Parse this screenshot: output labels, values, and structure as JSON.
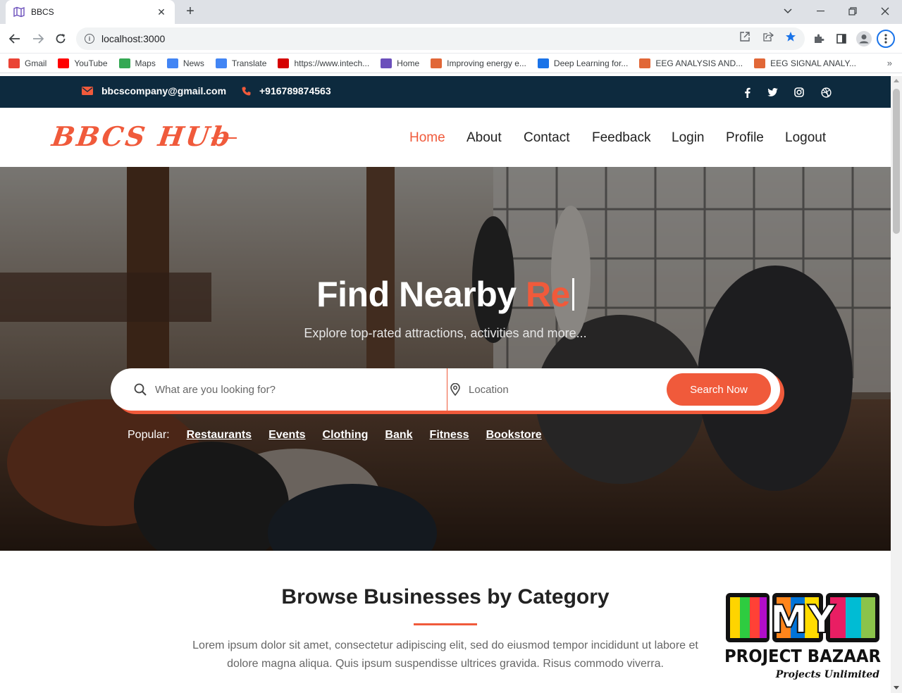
{
  "browser": {
    "tab_title": "BBCS",
    "url": "localhost:3000",
    "bookmarks": [
      {
        "label": "Gmail",
        "icon": "gmail-icon",
        "color": "#ea4335"
      },
      {
        "label": "YouTube",
        "icon": "youtube-icon",
        "color": "#ff0000"
      },
      {
        "label": "Maps",
        "icon": "maps-icon",
        "color": "#34a853"
      },
      {
        "label": "News",
        "icon": "news-icon",
        "color": "#4285f4"
      },
      {
        "label": "Translate",
        "icon": "translate-icon",
        "color": "#4285f4"
      },
      {
        "label": "https://www.intech...",
        "icon": "intech-icon",
        "color": "#d50000"
      },
      {
        "label": "Home",
        "icon": "map-outline-icon",
        "color": "#6b4fbb"
      },
      {
        "label": "Improving energy e...",
        "icon": "matlab-icon",
        "color": "#e16737"
      },
      {
        "label": "Deep Learning for...",
        "icon": "document-icon",
        "color": "#1a73e8"
      },
      {
        "label": "EEG ANALYSIS AND...",
        "icon": "matlab-icon",
        "color": "#e16737"
      },
      {
        "label": "EEG SIGNAL ANALY...",
        "icon": "matlab-icon",
        "color": "#e16737"
      }
    ]
  },
  "topbar": {
    "email": "bbcscompany@gmail.com",
    "phone": "+916789874563",
    "social_icons": [
      "facebook-icon",
      "twitter-icon",
      "instagram-icon",
      "dribbble-icon"
    ]
  },
  "navbar": {
    "logo": "BBCS HUb",
    "items": [
      "Home",
      "About",
      "Contact",
      "Feedback",
      "Login",
      "Profile",
      "Logout"
    ],
    "active": "Home"
  },
  "hero": {
    "title_prefix": "Find Nearby ",
    "title_accent": "Re",
    "subtitle": "Explore top-rated attractions, activities and more...",
    "search_placeholder": "What are you looking for?",
    "location_placeholder": "Location",
    "search_button": "Search Now",
    "popular_label": "Popular:",
    "popular_links": [
      "Restaurants",
      "Events",
      "Clothing",
      "Bank",
      "Fitness",
      "Bookstore"
    ]
  },
  "category_section": {
    "title": "Browse Businesses by Category",
    "description": "Lorem ipsum dolor sit amet, consectetur adipiscing elit, sed do eiusmod tempor incididunt ut labore et dolore magna aliqua. Quis ipsum suspendisse ultrices gravida. Risus commodo viverra."
  },
  "watermark": {
    "line1": "MY",
    "line2": "PROJECT BAZAAR",
    "line3": "Projects Unlimited"
  },
  "colors": {
    "accent": "#f05a3b",
    "topbar_bg": "#0d2a3e"
  }
}
